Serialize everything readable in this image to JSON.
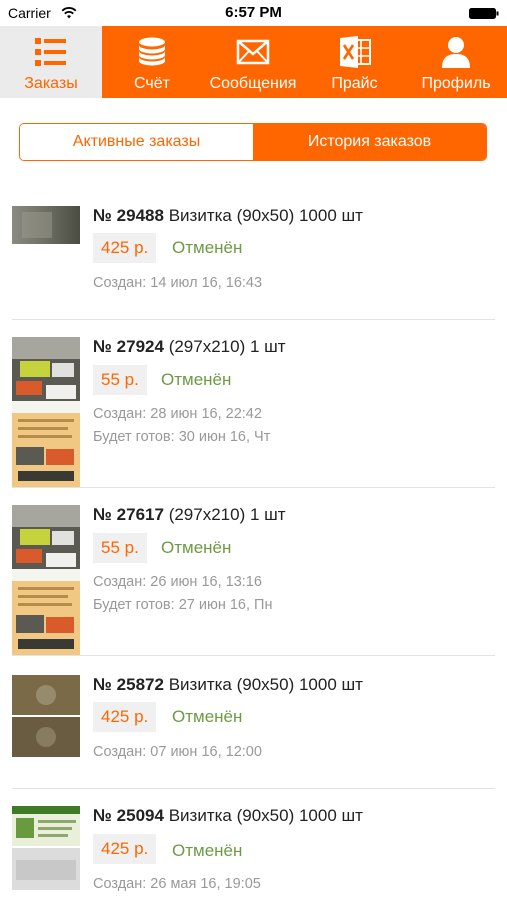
{
  "statusbar": {
    "carrier": "Carrier",
    "time": "6:57 PM"
  },
  "tabs": [
    {
      "label": "Заказы",
      "icon": "list-icon",
      "active": true
    },
    {
      "label": "Счёт",
      "icon": "coins-icon",
      "active": false
    },
    {
      "label": "Сообщения",
      "icon": "envelope-icon",
      "active": false
    },
    {
      "label": "Прайс",
      "icon": "excel-icon",
      "active": false
    },
    {
      "label": "Профиль",
      "icon": "user-icon",
      "active": false
    }
  ],
  "segments": {
    "active_orders": "Активные заказы",
    "history": "История заказов",
    "selected": "history"
  },
  "colors": {
    "accent": "#ff6600",
    "status_cancelled": "#6f9a45",
    "muted": "#999999"
  },
  "orders": [
    {
      "number": "№ 29488",
      "desc": "Визитка (90x50) 1000 шт",
      "price": "425 р.",
      "status": "Отменён",
      "created": "Создан: 14 июл 16, 16:43",
      "ready": ""
    },
    {
      "number": "№ 27924",
      "desc": "(297x210) 1 шт",
      "price": "55 р.",
      "status": "Отменён",
      "created": "Создан: 28 июн 16, 22:42",
      "ready": "Будет готов: 30 июн 16, Чт"
    },
    {
      "number": "№ 27617",
      "desc": "(297x210) 1 шт",
      "price": "55 р.",
      "status": "Отменён",
      "created": "Создан: 26 июн 16, 13:16",
      "ready": "Будет готов: 27 июн 16, Пн"
    },
    {
      "number": "№ 25872",
      "desc": "Визитка (90x50) 1000 шт",
      "price": "425 р.",
      "status": "Отменён",
      "created": "Создан: 07 июн 16, 12:00",
      "ready": ""
    },
    {
      "number": "№ 25094",
      "desc": "Визитка (90x50) 1000 шт",
      "price": "425 р.",
      "status": "Отменён",
      "created": "Создан: 26 мая 16, 19:05",
      "ready": ""
    }
  ]
}
